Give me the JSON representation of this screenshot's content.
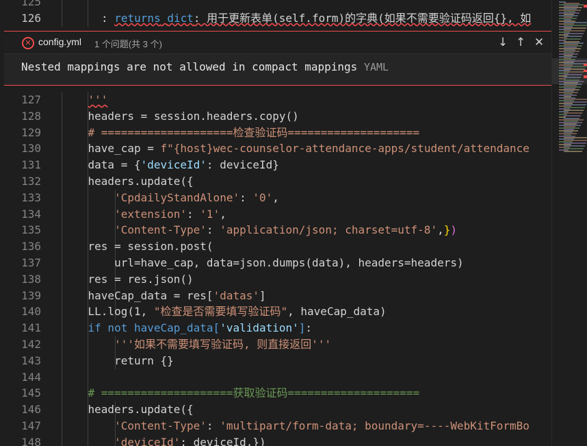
{
  "peek": {
    "file": "config.yml",
    "count": "1 个问题(共 3 个)",
    "message": "Nested mappings are not allowed in compact mappings",
    "source": "YAML",
    "down_icon": "arrow-down-icon",
    "up_icon": "arrow-up-icon",
    "close_icon": "close-icon"
  },
  "colors": {
    "error": "#f14c4c",
    "string": "#ce9178",
    "keyword": "#569cd6",
    "comment": "#6a9955",
    "variable": "#9cdcfe"
  },
  "lines": [
    {
      "n": "125",
      "segs": [
        [
          "",
          "d"
        ]
      ]
    },
    {
      "n": "126",
      "segs": [
        [
          ": ",
          "d"
        ],
        [
          "returns",
          "k"
        ],
        [
          " ",
          "d"
        ],
        [
          "dict",
          "k"
        ],
        [
          ": 用于更新表单(self.form)的字典(如果不需要验证码返回{}, 如",
          "d"
        ]
      ]
    },
    {
      "n": "127",
      "segs": [
        [
          "    ",
          "d"
        ],
        [
          "'''",
          "sq"
        ]
      ]
    },
    {
      "n": "128",
      "segs": [
        [
          "    headers = session.headers.copy()",
          "d"
        ]
      ]
    },
    {
      "n": "129",
      "segs": [
        [
          "    ",
          "d"
        ],
        [
          "# ====================检查验证码====================",
          "s"
        ]
      ]
    },
    {
      "n": "130",
      "segs": [
        [
          "    have_cap = ",
          "d"
        ],
        [
          "f\"{host}wec-counselor-attendance-apps/student/attendance",
          "s"
        ]
      ]
    },
    {
      "n": "131",
      "segs": [
        [
          "    data = {",
          "d"
        ],
        [
          "'deviceId'",
          "v"
        ],
        [
          ": deviceId}",
          "d"
        ]
      ]
    },
    {
      "n": "132",
      "segs": [
        [
          "    headers.update({",
          "d"
        ]
      ]
    },
    {
      "n": "133",
      "segs": [
        [
          "        ",
          "d"
        ],
        [
          "'CpdailyStandAlone'",
          "s"
        ],
        [
          ": ",
          "d"
        ],
        [
          "'0'",
          "s"
        ],
        [
          ",",
          "d"
        ]
      ]
    },
    {
      "n": "134",
      "segs": [
        [
          "        ",
          "d"
        ],
        [
          "'extension'",
          "s"
        ],
        [
          ": ",
          "d"
        ],
        [
          "'1'",
          "s"
        ],
        [
          ",",
          "d"
        ]
      ]
    },
    {
      "n": "135",
      "segs": [
        [
          "        ",
          "d"
        ],
        [
          "'Content-Type'",
          "s"
        ],
        [
          ": ",
          "d"
        ],
        [
          "'application/json; charset=utf-8'",
          "s"
        ],
        [
          ",",
          "d"
        ],
        [
          "}",
          "y"
        ],
        [
          ")",
          "p"
        ]
      ]
    },
    {
      "n": "136",
      "segs": [
        [
          "    res = session.post(",
          "d"
        ]
      ]
    },
    {
      "n": "137",
      "segs": [
        [
          "        url=have_cap, data=json.dumps(data), headers=headers)",
          "d"
        ]
      ]
    },
    {
      "n": "138",
      "segs": [
        [
          "    res = res.json()",
          "d"
        ]
      ]
    },
    {
      "n": "139",
      "segs": [
        [
          "    haveCap_data = res[",
          "d"
        ],
        [
          "'datas'",
          "s"
        ],
        [
          "]",
          "d"
        ]
      ]
    },
    {
      "n": "140",
      "segs": [
        [
          "    LL.log(1, ",
          "d"
        ],
        [
          "\"检查是否需要填写验证码\"",
          "s"
        ],
        [
          ", haveCap_data)",
          "d"
        ]
      ]
    },
    {
      "n": "141",
      "segs": [
        [
          "    ",
          "d"
        ],
        [
          "if not haveCap_data[",
          "k"
        ],
        [
          "'validation'",
          "v"
        ],
        [
          "]",
          "k"
        ],
        [
          ":",
          "d"
        ]
      ]
    },
    {
      "n": "142",
      "segs": [
        [
          "        ",
          "d"
        ],
        [
          "'''如果不需要填写验证码, 则直接返回'''",
          "s"
        ]
      ]
    },
    {
      "n": "143",
      "segs": [
        [
          "        return {}",
          "d"
        ]
      ]
    },
    {
      "n": "144",
      "segs": [
        [
          "",
          "d"
        ]
      ]
    },
    {
      "n": "145",
      "segs": [
        [
          "    ",
          "d"
        ],
        [
          "# ====================获取验证码====================",
          "c"
        ]
      ]
    },
    {
      "n": "146",
      "segs": [
        [
          "    headers.update({",
          "d"
        ]
      ]
    },
    {
      "n": "147",
      "segs": [
        [
          "        ",
          "d"
        ],
        [
          "'Content-Type'",
          "s"
        ],
        [
          ": ",
          "d"
        ],
        [
          "'multipart/form-data; boundary=----WebKitFormBo",
          "s"
        ]
      ]
    },
    {
      "n": "148",
      "segs": [
        [
          "        ",
          "d"
        ],
        [
          "'deviceId'",
          "s"
        ],
        [
          ": deviceId,})",
          "d"
        ]
      ]
    }
  ]
}
